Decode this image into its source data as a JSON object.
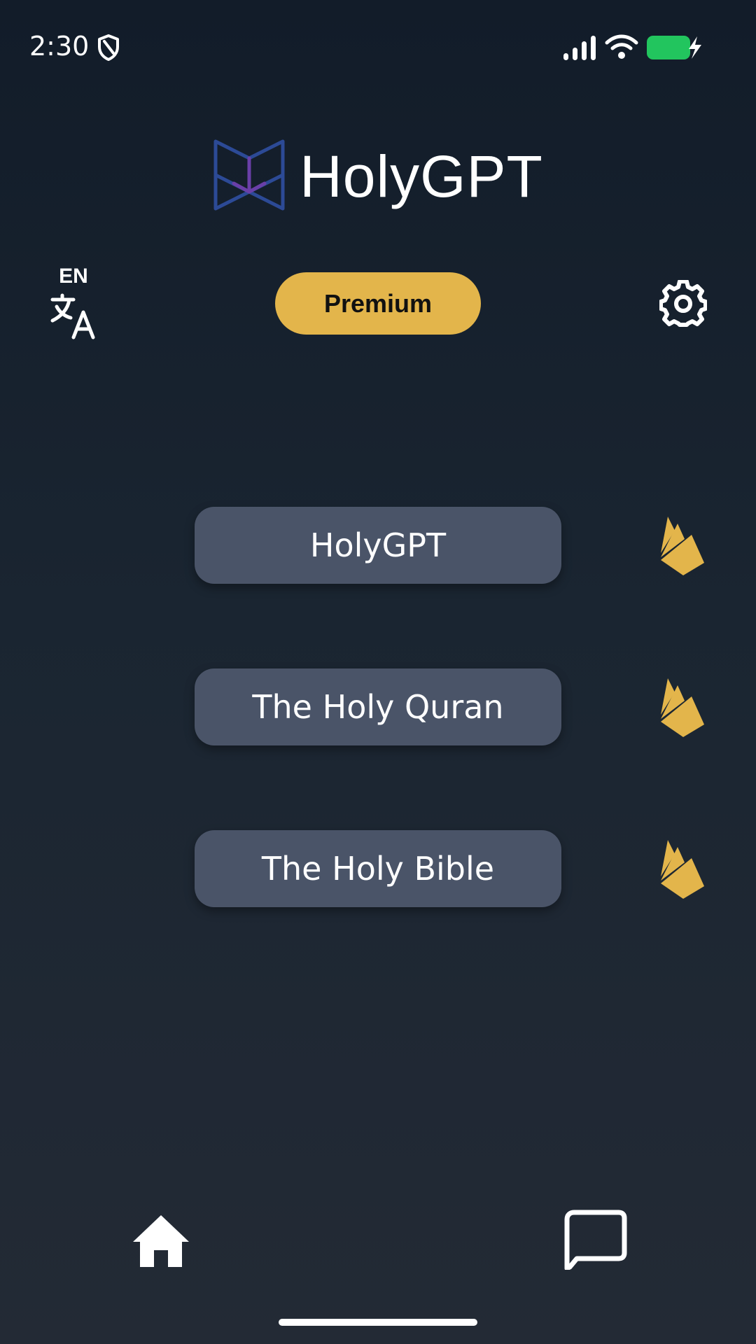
{
  "status_bar": {
    "time": "2:30",
    "icons": [
      "shield-icon",
      "signal-icon",
      "wifi-icon",
      "battery-charging-icon"
    ],
    "battery_color": "#22c55e"
  },
  "header": {
    "title": "HolyGPT",
    "logo_icon": "book-logo-icon",
    "logo_colors": [
      "#2f4b9c",
      "#6a3fa8"
    ]
  },
  "language": {
    "code": "EN",
    "icon": "translate-icon"
  },
  "premium": {
    "label": "Premium",
    "color": "#e3b54b"
  },
  "settings": {
    "icon": "gear-icon"
  },
  "menu": {
    "items": [
      {
        "label": "HolyGPT",
        "icon": "firebase-icon"
      },
      {
        "label": "The Holy Quran",
        "icon": "firebase-icon"
      },
      {
        "label": "The Holy Bible",
        "icon": "firebase-icon"
      }
    ],
    "button_color": "#4a5468",
    "icon_color": "#e3b54b"
  },
  "bottom_nav": {
    "items": [
      {
        "icon": "home-icon"
      },
      {
        "icon": "chat-icon"
      }
    ]
  }
}
